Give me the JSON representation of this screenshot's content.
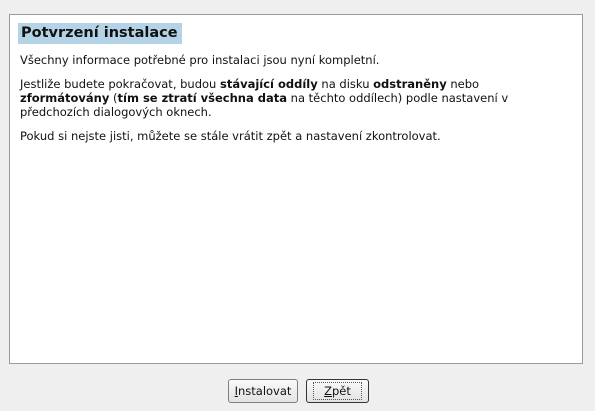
{
  "panel": {
    "title": "Potvrzení instalace",
    "para1": "Všechny informace potřebné pro instalaci jsou nyní kompletní.",
    "para2": {
      "t1": "Jestliže budete pokračovat, budou ",
      "b1": "stávající oddíly",
      "t2": " na disku ",
      "b2": "odstraněny",
      "t3": " nebo ",
      "b3": "zformátovány",
      "t4": " (",
      "b4": "tím se ztratí všechna data",
      "t5": " na těchto oddílech) podle nastavení v předchozích dialogových oknech."
    },
    "para3": "Pokud si nejste jisti, můžete se stále vrátit zpět a nastavení zkontrolovat."
  },
  "buttons": {
    "install": {
      "mnemonic": "I",
      "rest": "nstalovat"
    },
    "back": {
      "mnemonic": "Z",
      "rest": "pět"
    }
  }
}
